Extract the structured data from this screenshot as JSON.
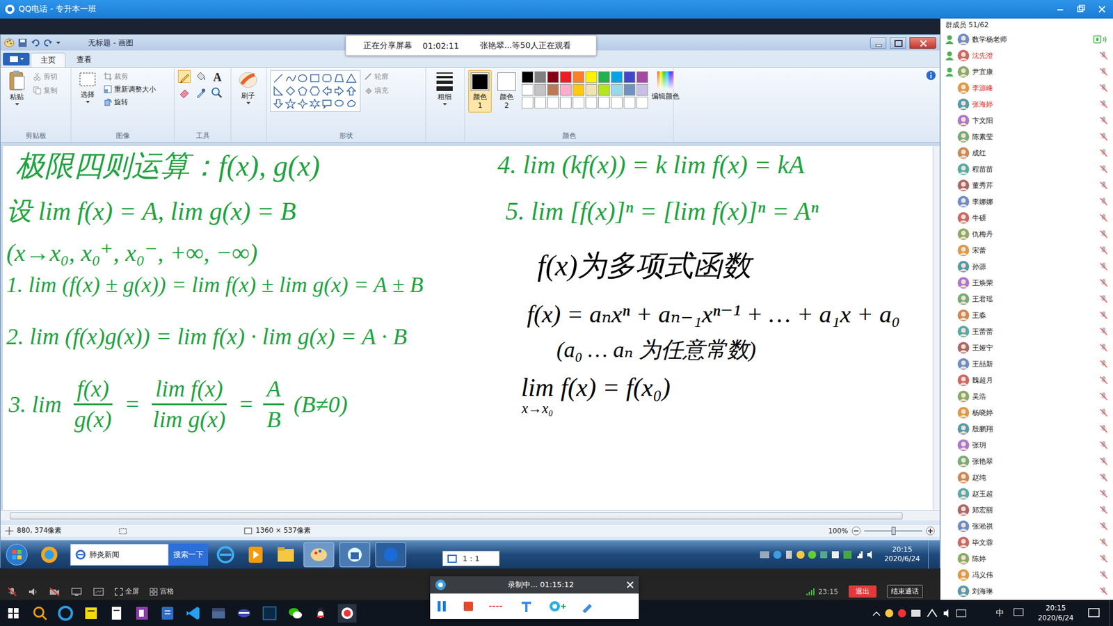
{
  "window": {
    "title": "QQ电话 - 专升本一班"
  },
  "share_banner": {
    "label": "正在分享屏幕",
    "time": "01:02:11",
    "viewers": "张艳翠...等50人正在观看"
  },
  "paint": {
    "title": "无标题 - 画图",
    "tabs": [
      {
        "label": "主页",
        "selected": true
      },
      {
        "label": "查看",
        "selected": false
      }
    ],
    "ribbon": {
      "clipboard": {
        "label": "剪贴板",
        "paste": "粘贴",
        "items": [
          {
            "label": "剪切",
            "disabled": true
          },
          {
            "label": "复制",
            "disabled": true
          }
        ]
      },
      "image": {
        "label": "图像",
        "select": "选择",
        "items": [
          {
            "label": "裁剪",
            "disabled": true
          },
          {
            "label": "重新调整大小",
            "disabled": false
          },
          {
            "label": "旋转",
            "disabled": false
          }
        ]
      },
      "tools": {
        "label": "工具",
        "text_icon": "A"
      },
      "brushes": {
        "label": "刷子"
      },
      "shapes": {
        "label": "形状",
        "items": [
          {
            "label": "轮廓",
            "disabled": true
          },
          {
            "label": "填充",
            "disabled": true
          }
        ]
      },
      "size": {
        "label": "粗细"
      },
      "colors": {
        "label": "颜色",
        "color1": {
          "label": "颜色 1",
          "color": "#000000",
          "selected": true
        },
        "color2": {
          "label": "颜色 2",
          "color": "#ffffff",
          "selected": false
        },
        "palette": [
          {
            "color": "#000000"
          },
          {
            "color": "#7f7f7f"
          },
          {
            "color": "#880015"
          },
          {
            "color": "#ed1c24"
          },
          {
            "color": "#ff7f27"
          },
          {
            "color": "#fff200"
          },
          {
            "color": "#22b14c"
          },
          {
            "color": "#00a2e8"
          },
          {
            "color": "#3f48cc"
          },
          {
            "color": "#a349a4"
          },
          {
            "color": "#ffffff"
          },
          {
            "color": "#c3c3c3"
          },
          {
            "color": "#b97a57"
          },
          {
            "color": "#ffaec9"
          },
          {
            "color": "#ffc90e"
          },
          {
            "color": "#efe4b0"
          },
          {
            "color": "#b5e61d"
          },
          {
            "color": "#99d9ea"
          },
          {
            "color": "#7092be"
          },
          {
            "color": "#c8bfe7"
          },
          {
            "color": "#ffffff"
          },
          {
            "color": "#ffffff"
          },
          {
            "color": "#ffffff"
          },
          {
            "color": "#ffffff"
          },
          {
            "color": "#ffffff"
          },
          {
            "color": "#ffffff"
          },
          {
            "color": "#ffffff"
          },
          {
            "color": "#ffffff"
          },
          {
            "color": "#ffffff"
          },
          {
            "color": "#ffffff"
          }
        ],
        "edit": "编辑颜色"
      }
    },
    "canvas": {
      "notes": [
        {
          "kind": "text",
          "text": "极限四则运算：f(x), g(x)",
          "color": "#1fa33f"
        },
        {
          "kind": "text",
          "text": "设 lim f(x) = A, lim g(x) = B",
          "color": "#1fa33f"
        },
        {
          "kind": "text",
          "text": "(x→x₀, x₀⁺, x₀⁻, +∞, −∞)",
          "color": "#1fa33f"
        },
        {
          "kind": "text",
          "text": "1. lim (f(x) ± g(x)) = lim f(x) ± lim g(x) = A ± B",
          "color": "#1fa33f"
        },
        {
          "kind": "text",
          "text": "2. lim (f(x)g(x)) = lim f(x) · lim g(x) = A · B",
          "color": "#1fa33f"
        },
        {
          "kind": "fractions",
          "color": "#1fa33f",
          "parts": [
            {
              "kind": "text",
              "text": "3. lim"
            },
            {
              "kind": "frac",
              "num": "f(x)",
              "den": "g(x)"
            },
            {
              "kind": "text",
              "text": "="
            },
            {
              "kind": "frac",
              "num": "lim f(x)",
              "den": "lim g(x)"
            },
            {
              "kind": "text",
              "text": "="
            },
            {
              "kind": "frac",
              "num": "A",
              "den": "B"
            },
            {
              "kind": "text",
              "text": "(B≠0)"
            }
          ]
        },
        {
          "kind": "text",
          "text": "4. lim (kf(x)) = k lim f(x) = kA",
          "color": "#1fa33f"
        },
        {
          "kind": "text",
          "text": "5. lim [f(x)]ⁿ = [lim f(x)]ⁿ = Aⁿ",
          "color": "#1fa33f"
        },
        {
          "kind": "text",
          "text": "f(x)为多项式函数",
          "color": "#000000"
        },
        {
          "kind": "text",
          "text": "f(x) = aₙxⁿ + aₙ₋₁xⁿ⁻¹ + … + a₁x + a₀",
          "color": "#000000"
        },
        {
          "kind": "text",
          "text": "(a₀ … aₙ 为任意常数)",
          "color": "#000000"
        },
        {
          "kind": "limit",
          "lim": "lim",
          "sub": "x→x₀",
          "rest": "f(x) = f(x₀)",
          "color": "#000000"
        }
      ],
      "hscroll": {
        "level": 0.97
      }
    },
    "status": {
      "cursor": "880, 374像素",
      "size": "1360 × 537像素",
      "zoom": "100%",
      "zoom_level": 0.5
    }
  },
  "win7_taskbar": {
    "news": "肺炎新闻",
    "search": "搜索一下",
    "ratio_tip": "1 : 1",
    "time": "20:15",
    "date": "2020/6/24"
  },
  "members": {
    "header": "群成员 51/62",
    "list": [
      {
        "name": "数学杨老师",
        "admin": true,
        "mic": "speaking",
        "color": "#222222"
      },
      {
        "name": "沈先澄",
        "admin": true,
        "mic": "muted",
        "color": "#e0241b"
      },
      {
        "name": "尹宜康",
        "admin": true,
        "mic": "muted",
        "color": "#222222"
      },
      {
        "name": "李源峰",
        "admin": false,
        "mic": "muted",
        "color": "#e0241b"
      },
      {
        "name": "张海婷",
        "admin": false,
        "mic": "muted",
        "color": "#e0241b"
      },
      {
        "name": "卞文阳",
        "admin": false,
        "mic": "muted",
        "color": "#222222"
      },
      {
        "name": "陈素莹",
        "admin": false,
        "mic": "muted",
        "color": "#222222"
      },
      {
        "name": "成红",
        "admin": false,
        "mic": "muted",
        "color": "#222222"
      },
      {
        "name": "程苗苗",
        "admin": false,
        "mic": "muted",
        "color": "#222222"
      },
      {
        "name": "董秀芹",
        "admin": false,
        "mic": "muted",
        "color": "#222222"
      },
      {
        "name": "李娜娜",
        "admin": false,
        "mic": "muted",
        "color": "#222222"
      },
      {
        "name": "牛硕",
        "admin": false,
        "mic": "muted",
        "color": "#222222"
      },
      {
        "name": "仇梅丹",
        "admin": false,
        "mic": "muted",
        "color": "#222222"
      },
      {
        "name": "宋蕾",
        "admin": false,
        "mic": "muted",
        "color": "#222222"
      },
      {
        "name": "孙源",
        "admin": false,
        "mic": "muted",
        "color": "#222222"
      },
      {
        "name": "王焕荣",
        "admin": false,
        "mic": "muted",
        "color": "#222222"
      },
      {
        "name": "王君瑶",
        "admin": false,
        "mic": "muted",
        "color": "#222222"
      },
      {
        "name": "王淼",
        "admin": false,
        "mic": "muted",
        "color": "#222222"
      },
      {
        "name": "王蕾蕾",
        "admin": false,
        "mic": "muted",
        "color": "#222222"
      },
      {
        "name": "王娅宁",
        "admin": false,
        "mic": "muted",
        "color": "#222222"
      },
      {
        "name": "王喆新",
        "admin": false,
        "mic": "muted",
        "color": "#222222"
      },
      {
        "name": "魏超月",
        "admin": false,
        "mic": "muted",
        "color": "#222222"
      },
      {
        "name": "吴浩",
        "admin": false,
        "mic": "muted",
        "color": "#222222"
      },
      {
        "name": "杨晓婷",
        "admin": false,
        "mic": "muted",
        "color": "#222222"
      },
      {
        "name": "殷鹏翔",
        "admin": false,
        "mic": "muted",
        "color": "#222222"
      },
      {
        "name": "张玥",
        "admin": false,
        "mic": "muted",
        "color": "#222222"
      },
      {
        "name": "张艳翠",
        "admin": false,
        "mic": "muted",
        "color": "#222222"
      },
      {
        "name": "赵纯",
        "admin": false,
        "mic": "muted",
        "color": "#222222"
      },
      {
        "name": "赵玉超",
        "admin": false,
        "mic": "muted",
        "color": "#222222"
      },
      {
        "name": "郑宏丽",
        "admin": false,
        "mic": "muted",
        "color": "#222222"
      },
      {
        "name": "张淞祺",
        "admin": false,
        "mic": "muted",
        "color": "#222222"
      },
      {
        "name": "毕文蓉",
        "admin": false,
        "mic": "muted",
        "color": "#222222"
      },
      {
        "name": "陈婷",
        "admin": false,
        "mic": "muted",
        "color": "#222222"
      },
      {
        "name": "冯义伟",
        "admin": false,
        "mic": "muted",
        "color": "#222222"
      },
      {
        "name": "刘海琳",
        "admin": false,
        "mic": "muted",
        "color": "#222222"
      }
    ]
  },
  "call_toolbar": {
    "fullscreen": "全屏",
    "grid": "宫格",
    "duration": "23:15",
    "exit": "退出",
    "end": "结束通话"
  },
  "recorder": {
    "status": "录制中... 01:15:12"
  },
  "taskbar": {
    "ime": "中",
    "time": "20:15",
    "date": "2020/6/24"
  }
}
